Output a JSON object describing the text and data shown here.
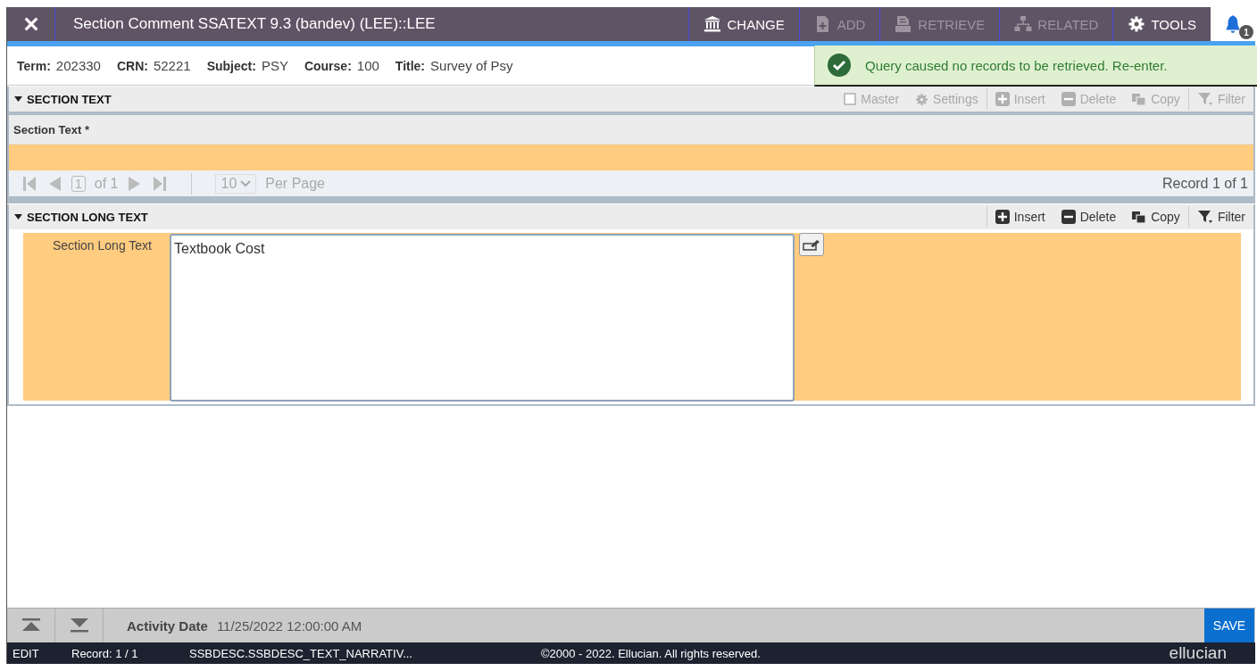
{
  "header": {
    "title": "Section Comment SSATEXT 9.3 (bandev) (LEE)::LEE",
    "actions": [
      {
        "kind": "bank",
        "label": "CHANGE",
        "disabled": false
      },
      {
        "kind": "add",
        "label": "ADD",
        "disabled": true
      },
      {
        "kind": "retrieve",
        "label": "RETRIEVE",
        "disabled": true
      },
      {
        "kind": "related",
        "label": "RELATED",
        "disabled": true
      },
      {
        "kind": "tools",
        "label": "TOOLS",
        "disabled": false
      }
    ],
    "notification_count": "1"
  },
  "info": [
    {
      "label": "Term:",
      "value": "202330"
    },
    {
      "label": "CRN:",
      "value": "52221"
    },
    {
      "label": "Subject:",
      "value": "PSY"
    },
    {
      "label": "Course:",
      "value": "100"
    },
    {
      "label": "Title:",
      "value": "Survey of Psy"
    }
  ],
  "toast": {
    "message": "Query caused no records to be retrieved. Re-enter."
  },
  "section_text": {
    "title": "SECTION TEXT",
    "tools": [
      {
        "kind": "checkbox",
        "label": "Master",
        "disabled": true,
        "checked": false
      },
      {
        "kind": "settings",
        "label": "Settings",
        "disabled": true
      },
      {
        "kind": "insert",
        "label": "Insert",
        "disabled": true
      },
      {
        "kind": "delete",
        "label": "Delete",
        "disabled": true
      },
      {
        "kind": "copy",
        "label": "Copy",
        "disabled": true
      },
      {
        "kind": "filter",
        "label": "Filter",
        "disabled": true
      }
    ],
    "column": "Section Text *",
    "pager": {
      "page": "1",
      "of": "of 1",
      "per_page": "10",
      "per_page_label": "Per Page",
      "record": "Record 1 of 1"
    }
  },
  "section_long_text": {
    "title": "SECTION LONG TEXT",
    "tools": [
      {
        "kind": "insert",
        "label": "Insert",
        "disabled": false
      },
      {
        "kind": "delete",
        "label": "Delete",
        "disabled": false
      },
      {
        "kind": "copy",
        "label": "Copy",
        "disabled": false
      },
      {
        "kind": "filter",
        "label": "Filter",
        "disabled": false
      }
    ],
    "field_label": "Section Long Text",
    "value": "Textbook Cost"
  },
  "footer": {
    "activity_label": "Activity Date",
    "activity_value": "11/25/2022 12:00:00 AM",
    "save": "SAVE"
  },
  "status_bar": {
    "mode": "EDIT",
    "record": "Record: 1 / 1",
    "field": "SSBDESC.SSBDESC_TEXT_NARRATIV...",
    "copyright": "©2000 - 2022. Ellucian. All rights reserved.",
    "logo": "ellucian"
  }
}
